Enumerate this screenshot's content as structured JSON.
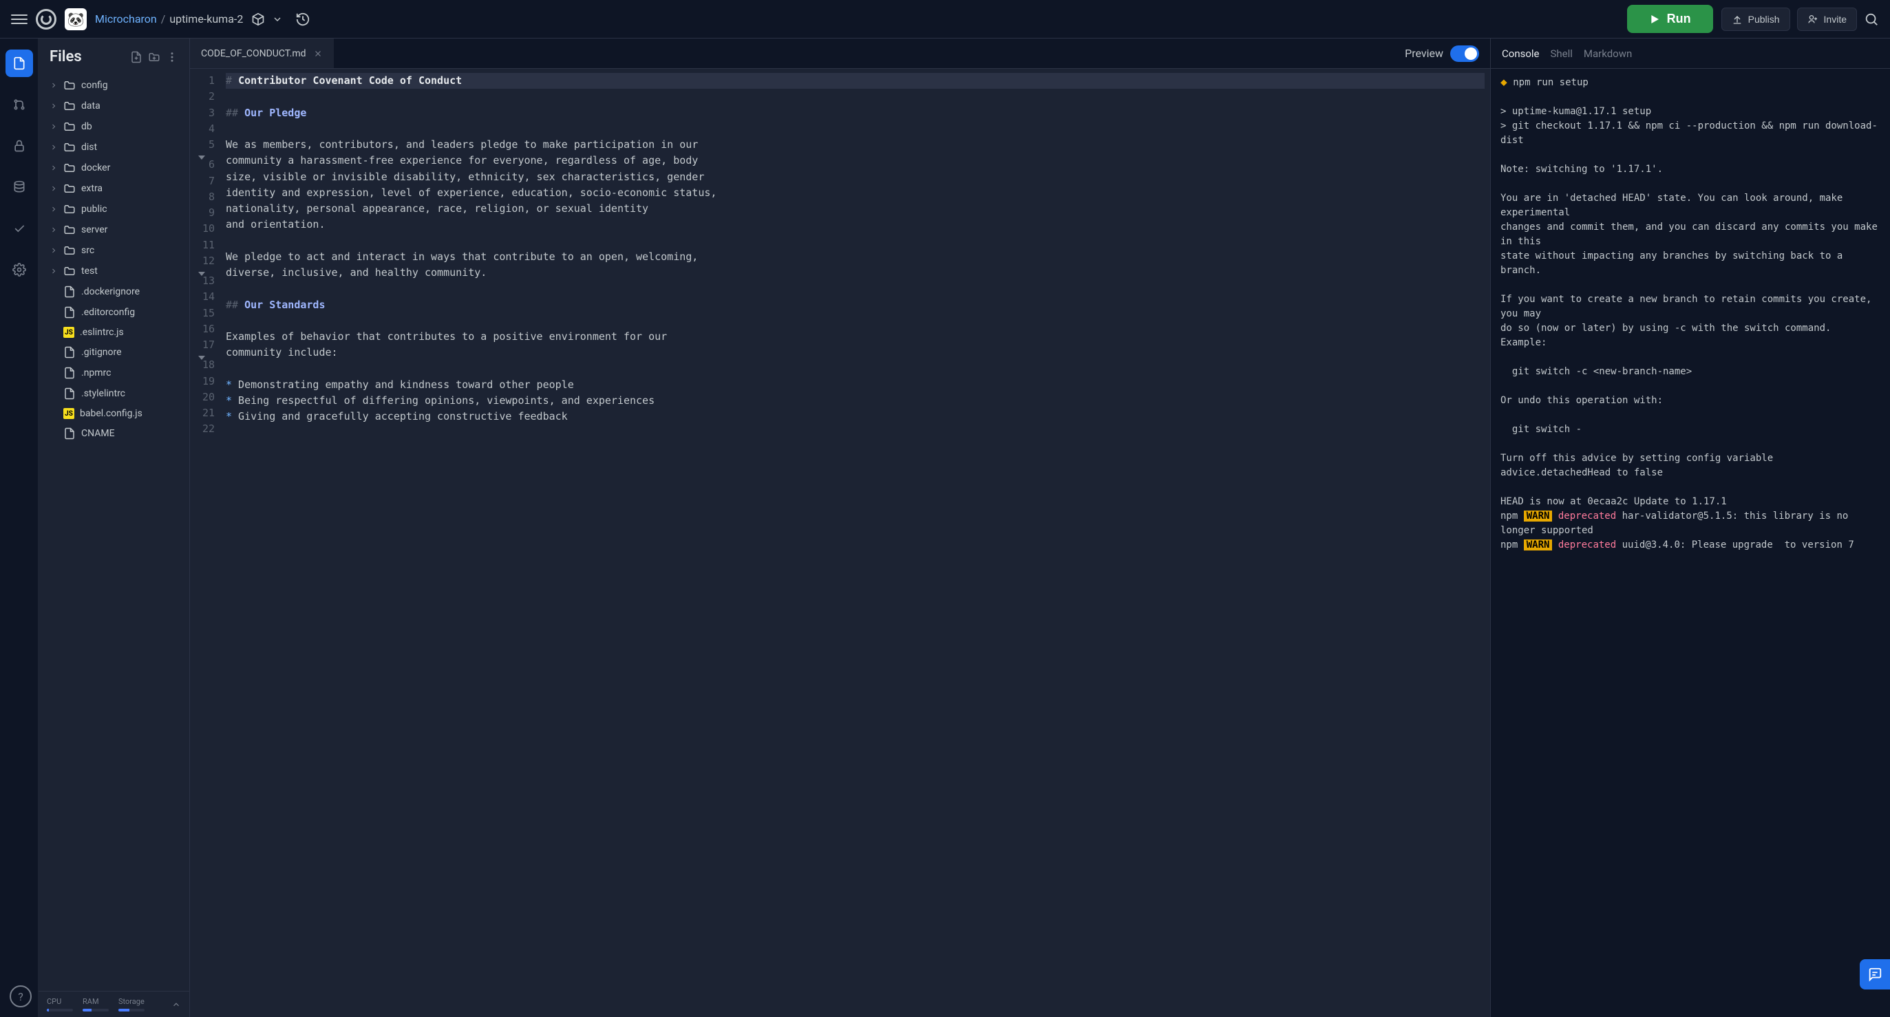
{
  "header": {
    "user": "Microcharon",
    "separator": "/",
    "repo": "uptime-kuma-2",
    "run_label": "Run",
    "publish_label": "Publish",
    "invite_label": "Invite"
  },
  "sidebar": {
    "title": "Files",
    "items": [
      {
        "type": "folder",
        "label": "config"
      },
      {
        "type": "folder",
        "label": "data"
      },
      {
        "type": "folder",
        "label": "db"
      },
      {
        "type": "folder",
        "label": "dist"
      },
      {
        "type": "folder",
        "label": "docker"
      },
      {
        "type": "folder",
        "label": "extra"
      },
      {
        "type": "folder",
        "label": "public"
      },
      {
        "type": "folder",
        "label": "server"
      },
      {
        "type": "folder",
        "label": "src"
      },
      {
        "type": "folder",
        "label": "test"
      },
      {
        "type": "file",
        "label": ".dockerignore"
      },
      {
        "type": "file",
        "label": ".editorconfig"
      },
      {
        "type": "js",
        "label": ".eslintrc.js"
      },
      {
        "type": "file",
        "label": ".gitignore"
      },
      {
        "type": "file",
        "label": ".npmrc"
      },
      {
        "type": "file",
        "label": ".stylelintrc"
      },
      {
        "type": "js",
        "label": "babel.config.js"
      },
      {
        "type": "file",
        "label": "CNAME"
      }
    ],
    "stats": {
      "cpu": {
        "label": "CPU",
        "pct": 8
      },
      "ram": {
        "label": "RAM",
        "pct": 35
      },
      "storage": {
        "label": "Storage",
        "pct": 42
      }
    }
  },
  "editor": {
    "tab_name": "CODE_OF_CONDUCT.md",
    "preview_label": "Preview",
    "lines": [
      {
        "n": 1,
        "kind": "h1",
        "raw": "# Contributor Covenant Code of Conduct",
        "hl": true
      },
      {
        "n": 2,
        "kind": "blank",
        "raw": ""
      },
      {
        "n": 3,
        "kind": "h2",
        "raw": "## Our Pledge"
      },
      {
        "n": 4,
        "kind": "blank",
        "raw": ""
      },
      {
        "n": 5,
        "kind": "text",
        "fold": true,
        "raw": "We as members, contributors, and leaders pledge to make participation in our"
      },
      {
        "n": 6,
        "kind": "text",
        "raw": "community a harassment-free experience for everyone, regardless of age, body"
      },
      {
        "n": 7,
        "kind": "text",
        "raw": "size, visible or invisible disability, ethnicity, sex characteristics, gender"
      },
      {
        "n": 8,
        "kind": "text",
        "raw": "identity and expression, level of experience, education, socio-economic status,"
      },
      {
        "n": 9,
        "kind": "text",
        "raw": "nationality, personal appearance, race, religion, or sexual identity"
      },
      {
        "n": 10,
        "kind": "text",
        "raw": "and orientation."
      },
      {
        "n": 11,
        "kind": "blank",
        "raw": ""
      },
      {
        "n": 12,
        "kind": "text",
        "fold": true,
        "raw": "We pledge to act and interact in ways that contribute to an open, welcoming,"
      },
      {
        "n": 13,
        "kind": "text",
        "raw": "diverse, inclusive, and healthy community."
      },
      {
        "n": 14,
        "kind": "blank",
        "raw": ""
      },
      {
        "n": 15,
        "kind": "h2",
        "raw": "## Our Standards"
      },
      {
        "n": 16,
        "kind": "blank",
        "raw": ""
      },
      {
        "n": 17,
        "kind": "text",
        "fold": true,
        "raw": "Examples of behavior that contributes to a positive environment for our"
      },
      {
        "n": 18,
        "kind": "text",
        "raw": "community include:"
      },
      {
        "n": 19,
        "kind": "blank",
        "raw": ""
      },
      {
        "n": 20,
        "kind": "bullet",
        "raw": "* Demonstrating empathy and kindness toward other people"
      },
      {
        "n": 21,
        "kind": "bullet",
        "raw": "* Being respectful of differing opinions, viewpoints, and experiences"
      },
      {
        "n": 22,
        "kind": "bullet",
        "raw": "* Giving and gracefully accepting constructive feedback"
      }
    ]
  },
  "console": {
    "tabs": [
      "Console",
      "Shell",
      "Markdown"
    ],
    "active_tab": 0,
    "lines": [
      {
        "t": "prompt",
        "text": "npm run setup"
      },
      {
        "t": "blank"
      },
      {
        "t": "out",
        "text": "> uptime-kuma@1.17.1 setup"
      },
      {
        "t": "out",
        "text": "> git checkout 1.17.1 && npm ci --production && npm run download-dist"
      },
      {
        "t": "blank"
      },
      {
        "t": "out",
        "text": "Note: switching to '1.17.1'."
      },
      {
        "t": "blank"
      },
      {
        "t": "out",
        "text": "You are in 'detached HEAD' state. You can look around, make experimental"
      },
      {
        "t": "out",
        "text": "changes and commit them, and you can discard any commits you make in this"
      },
      {
        "t": "out",
        "text": "state without impacting any branches by switching back to a branch."
      },
      {
        "t": "blank"
      },
      {
        "t": "out",
        "text": "If you want to create a new branch to retain commits you create, you may"
      },
      {
        "t": "out",
        "text": "do so (now or later) by using -c with the switch command. Example:"
      },
      {
        "t": "blank"
      },
      {
        "t": "out",
        "text": "  git switch -c <new-branch-name>"
      },
      {
        "t": "blank"
      },
      {
        "t": "out",
        "text": "Or undo this operation with:"
      },
      {
        "t": "blank"
      },
      {
        "t": "out",
        "text": "  git switch -"
      },
      {
        "t": "blank"
      },
      {
        "t": "out",
        "text": "Turn off this advice by setting config variable advice.detachedHead to false"
      },
      {
        "t": "blank"
      },
      {
        "t": "out",
        "text": "HEAD is now at 0ecaa2c Update to 1.17.1"
      },
      {
        "t": "warn",
        "text": "npm WARN deprecated har-validator@5.1.5: this library is no longer supported"
      },
      {
        "t": "warn",
        "text": "npm WARN deprecated uuid@3.4.0: Please upgrade  to version 7"
      }
    ]
  }
}
